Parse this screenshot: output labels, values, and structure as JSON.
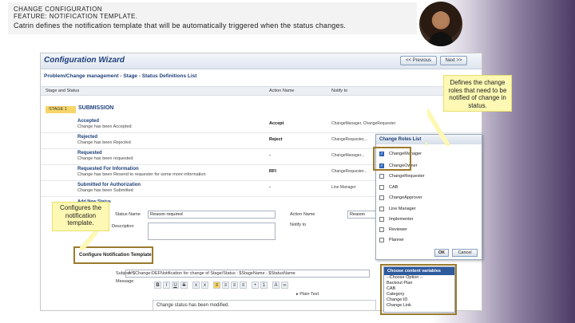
{
  "header": {
    "line1": "CHANGE CONFIGURATION",
    "line2": "FEATURE: NOTIFICATION TEMPLATE.",
    "line3": "Catrin defines the notification template that will be automatically triggered when the status changes."
  },
  "wizard": {
    "title": "Configuration Wizard",
    "prev_label": "<< Previous",
    "next_label": "Next >>",
    "breadcrumb": "Problem/Change management - Stage - Status Definitions List",
    "columns": {
      "stage": "Stage and Status",
      "action": "Action Name",
      "notify": "Notify to"
    },
    "stage_badge": "STAGE 1",
    "stage_title": "SUBMISSION",
    "rows": [
      {
        "title": "Accepted",
        "desc": "Change has been Accepted",
        "action": "Accept",
        "notify": "ChangeManager, ChangeRequester"
      },
      {
        "title": "Rejected",
        "desc": "Change has been Rejected",
        "action": "Reject",
        "notify": "ChangeRequester,..."
      },
      {
        "title": "Requested",
        "desc": "Change has been requested",
        "action": "-",
        "notify": "ChangeManager..."
      },
      {
        "title": "Requested For Information",
        "desc": "Change has been Resend to requester for some more information",
        "action": "RFI",
        "notify": "ChangeRequester..."
      },
      {
        "title": "Submitted for Authorization",
        "desc": "Change has been Submitted",
        "action": "-",
        "notify": "Line Manager"
      }
    ],
    "add_status": "Add New Status",
    "form": {
      "status_name_label": "Status Name",
      "status_name_value": "Reason required",
      "action_name_label": "Action Name",
      "action_name_value": "Reason",
      "description_label": "Description",
      "notify_label": "Notify to"
    },
    "config_template_label": "Configure Notification Template",
    "subject_label": "Subject",
    "subject_value": "##$Change:DEFNotification for change of Stage/Status : $StageName - $StatusName",
    "message_label": "Message",
    "plain_text": "Plain Text",
    "editor_text": "Change status has been modified."
  },
  "roles_popup": {
    "title": "Change Roles List",
    "items": [
      {
        "label": "ChangeManager",
        "checked": "✓"
      },
      {
        "label": "ChangeOwner",
        "checked": "✓"
      },
      {
        "label": "ChangeRequester",
        "checked": ""
      },
      {
        "label": "CAB",
        "checked": ""
      },
      {
        "label": "ChangeApprover",
        "checked": ""
      },
      {
        "label": "Line Manager",
        "checked": ""
      },
      {
        "label": "Implementer",
        "checked": ""
      },
      {
        "label": "Reviewer",
        "checked": ""
      },
      {
        "label": "Planner",
        "checked": ""
      }
    ],
    "ok_label": "OK",
    "cancel_label": "Cancel"
  },
  "vars_popup": {
    "title": "Choose content variables",
    "items": [
      "--Choose Option --",
      "Backout Plan",
      "CAB",
      "Category",
      "Change ID",
      "Change Link"
    ]
  },
  "callouts": {
    "roles": "Defines the change roles that need to be notified of change in status.",
    "template": "Configures the notification template."
  }
}
